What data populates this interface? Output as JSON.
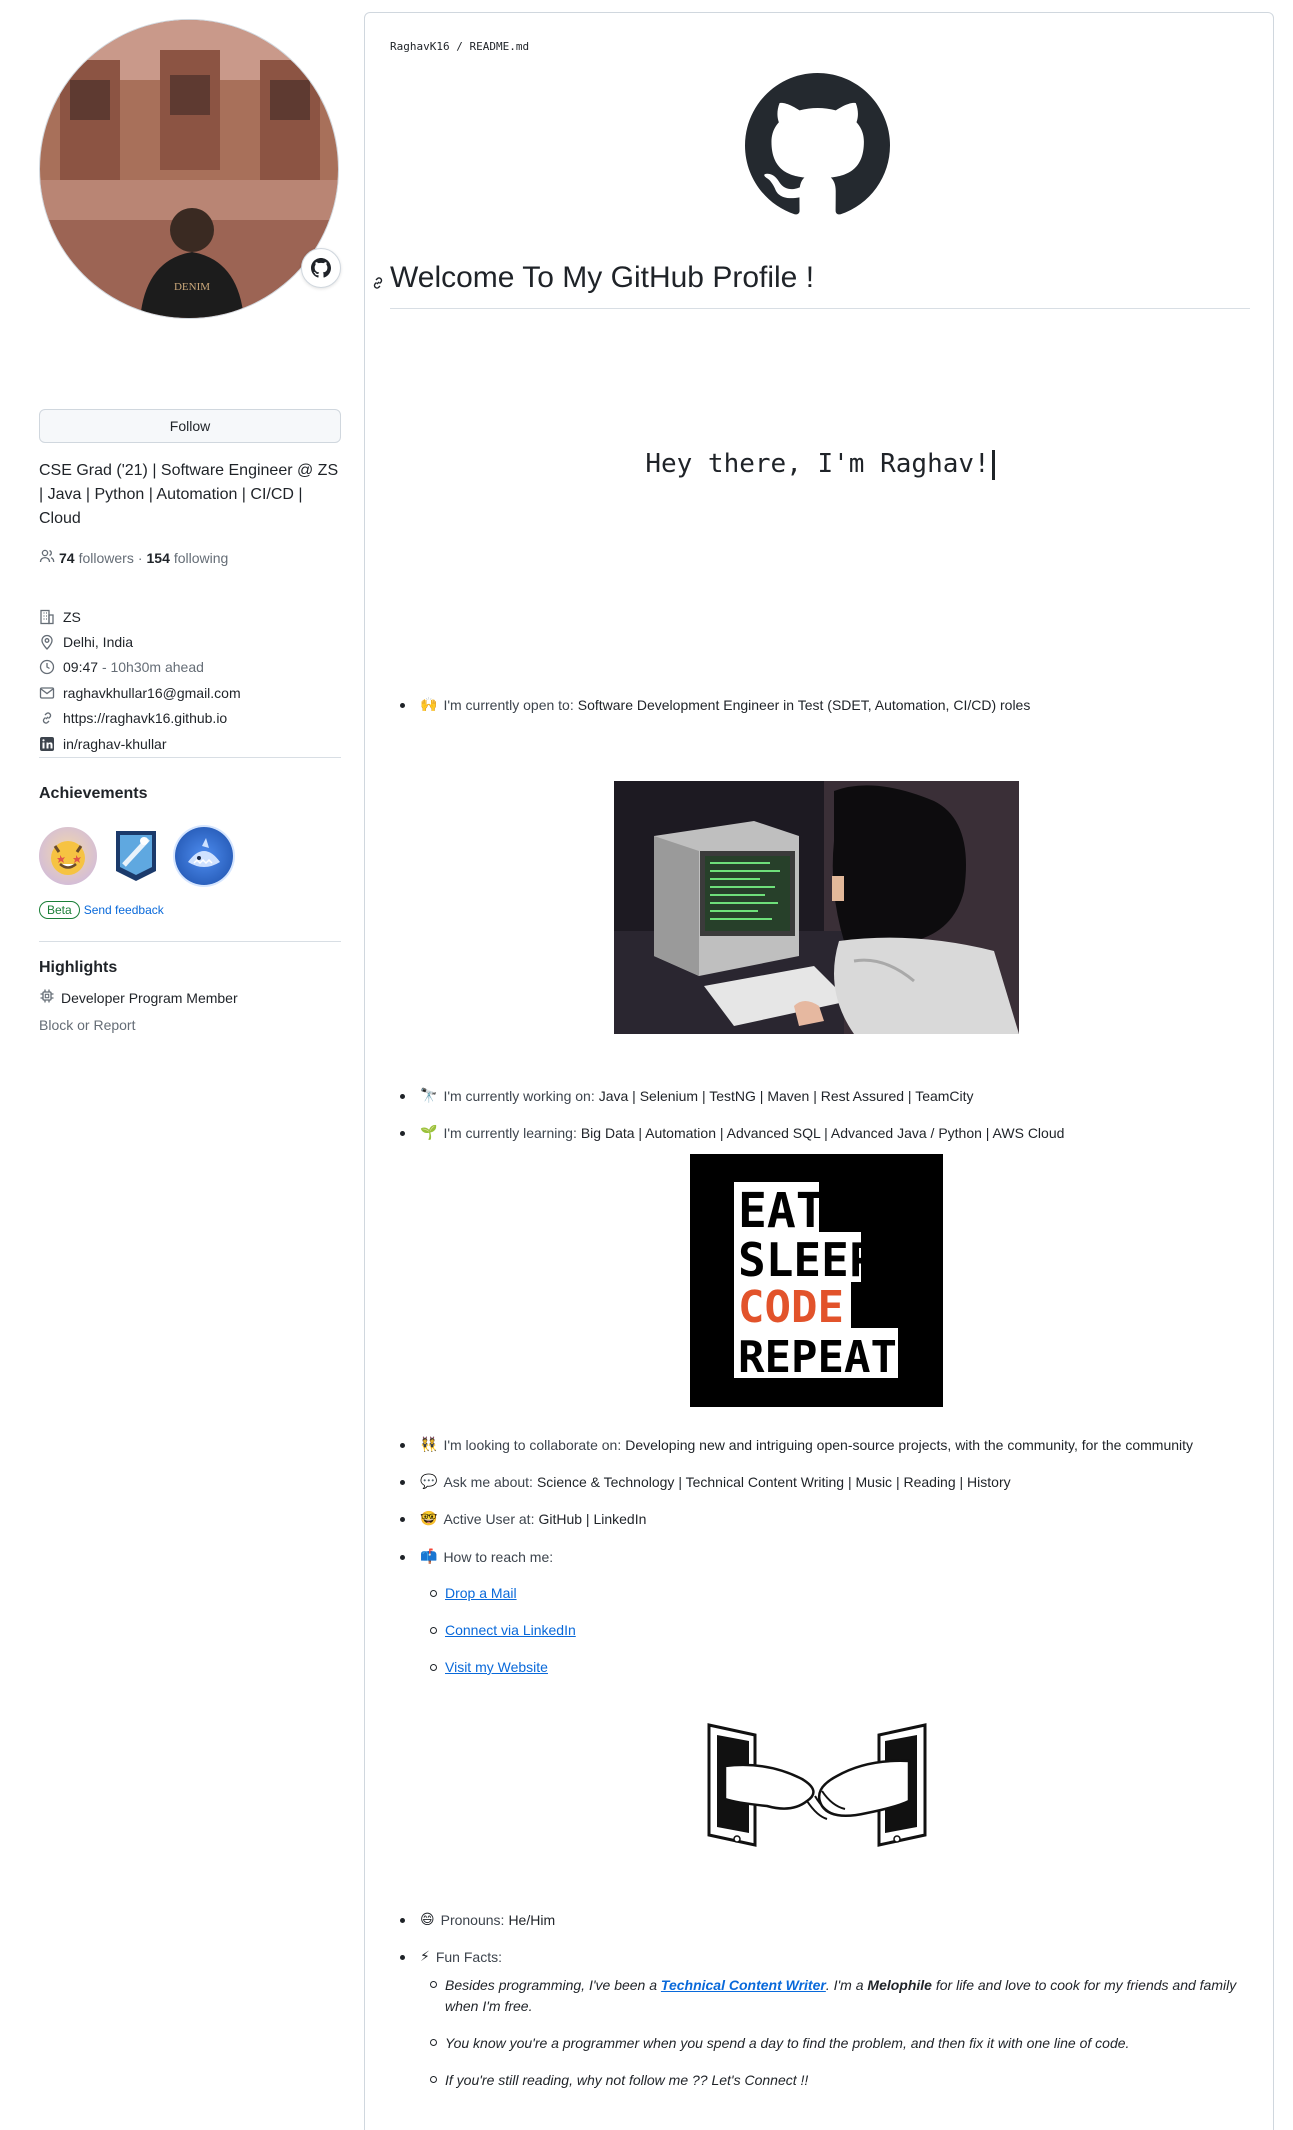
{
  "sidebar": {
    "follow_label": "Follow",
    "bio": "CSE Grad ('21) | Software Engineer @ ZS | Java | Python | Automation | CI/CD | Cloud",
    "followers_count": "74",
    "followers_label": "followers",
    "separator": "·",
    "following_count": "154",
    "following_label": "following",
    "company": "ZS",
    "location": "Delhi, India",
    "local_time": "09:47",
    "time_offset": "- 10h30m ahead",
    "email": "raghavkhullar16@gmail.com",
    "website": "https://raghavk16.github.io",
    "linkedin": "in/raghav-khullar",
    "achievements_title": "Achievements",
    "beta_label": "Beta",
    "feedback_label": "Send feedback",
    "highlights_title": "Highlights",
    "highlight_item": "Developer Program Member",
    "block_label": "Block or Report"
  },
  "readme": {
    "breadcrumb": "RaghavK16 / README.md",
    "heading": "Welcome To My GitHub Profile !",
    "typing_text": "Hey there, I'm Raghav!",
    "open_to": {
      "emoji": "🙌",
      "label": "I'm currently open to:",
      "value": "Software Development Engineer in Test (SDET, Automation, CI/CD) roles"
    },
    "working_on": {
      "emoji": "🔭",
      "label": "I'm currently working on:",
      "value": "Java | Selenium | TestNG | Maven | Rest Assured | TeamCity"
    },
    "learning": {
      "emoji": "🌱",
      "label": "I'm currently learning:",
      "value": "Big Data | Automation | Advanced SQL | Advanced Java / Python | AWS Cloud"
    },
    "eat_sleep": [
      "EAT",
      "SLEEP",
      "CODE",
      "REPEAT"
    ],
    "collaborate": {
      "emoji": "👯",
      "label": "I'm looking to collaborate on:",
      "value": "Developing new and intriguing open-source projects, with the community, for the community"
    },
    "ask_me": {
      "emoji": "💬",
      "label": "Ask me about:",
      "value": "Science & Technology | Technical Content Writing | Music | Reading | History"
    },
    "active_user": {
      "emoji": "🤓",
      "label": "Active User at:",
      "value": "GitHub | LinkedIn"
    },
    "reach_me": {
      "emoji": "📫",
      "label": "How to reach me:"
    },
    "reach_links": [
      "Drop a Mail",
      "Connect via LinkedIn",
      "Visit my Website"
    ],
    "pronouns": {
      "emoji": "😄",
      "label": "Pronouns:",
      "value": "He/Him"
    },
    "fun_facts": {
      "emoji": "⚡",
      "label": "Fun Facts:"
    },
    "fact1_a": "Besides programming, I've been a ",
    "fact1_link": "Technical Content Writer",
    "fact1_b": ". I'm a ",
    "fact1_bold": "Melophile",
    "fact1_c": " for life and love to cook for my friends and family when I'm free.",
    "fact2": "You know you're a programmer when you spend a day to find the problem, and then fix it with one line of code.",
    "fact3": "If you're still reading, why not follow me ?? Let's Connect !!"
  },
  "colors": {
    "link": "#0969da",
    "accent_green": "#1a7f37",
    "code_red": "#e2532b"
  }
}
